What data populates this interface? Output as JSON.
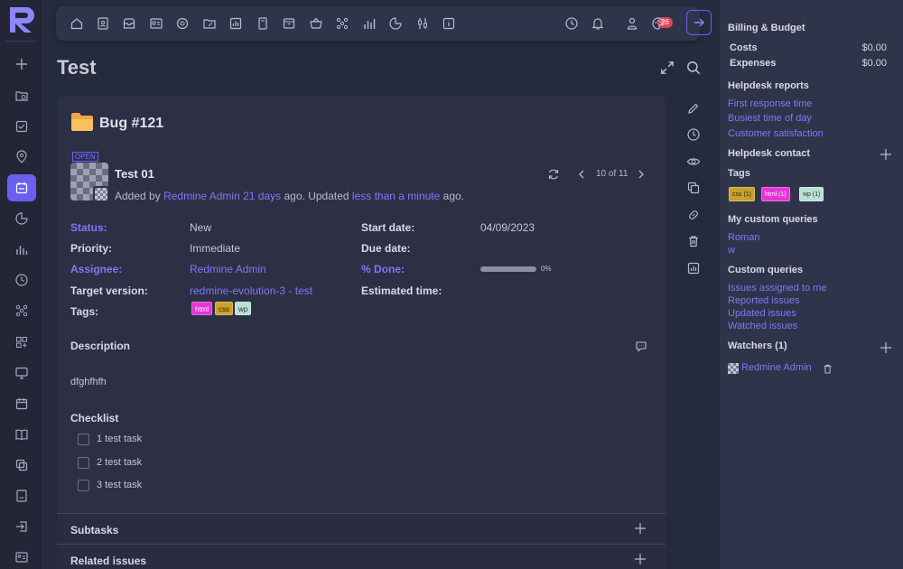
{
  "page": {
    "title": "Test"
  },
  "toolbar": {
    "icons": [
      "home-icon",
      "contacts-icon",
      "archive-icon",
      "id-card-icon",
      "target-icon",
      "folder-export-icon",
      "chart-icon",
      "notebook-icon",
      "inbox-icon",
      "basket-icon",
      "network-icon",
      "bars-icon",
      "pie-icon",
      "sliders-icon",
      "info-icon"
    ],
    "notifications_count": "26",
    "colors": {
      "accent": "#6b5ff0",
      "badge": "#e0455a"
    }
  },
  "issue": {
    "title": "Bug #121",
    "status_tag": "OPEN",
    "subject": "Test 01",
    "added_prefix": "Added by",
    "author": "Redmine Admin",
    "added_ago": "21 days",
    "middle": "ago. Updated",
    "updated_ago": "less than a minute",
    "suffix": "ago.",
    "pager": "10 of 11",
    "attributes": {
      "status_label": "Status:",
      "status_value": "New",
      "priority_label": "Priority:",
      "priority_value": "Immediate",
      "assignee_label": "Assignee:",
      "assignee_value": "Redmine Admin",
      "target_label": "Target version:",
      "target_value": "redmine-evolution-3 - test",
      "tags_label": "Tags:",
      "start_label": "Start date:",
      "start_value": "04/09/2023",
      "due_label": "Due date:",
      "done_label": "% Done:",
      "done_value": "0%",
      "done_fraction": 0,
      "estimated_label": "Estimated time:"
    },
    "tags": [
      {
        "label": "html",
        "color": "#e534d8"
      },
      {
        "label": "css",
        "color": "#c9a227"
      },
      {
        "label": "wp",
        "color": "#b9e0d8"
      }
    ],
    "description_title": "Description",
    "description": "dfghfhfh",
    "checklist_title": "Checklist",
    "checklist": [
      "1 test task",
      "2 test task",
      "3 test task"
    ],
    "subtasks_title": "Subtasks",
    "related_title": "Related issues"
  },
  "sidebar": {
    "billing_title": "Billing & Budget",
    "costs_label": "Costs",
    "costs_value": "$0.00",
    "expenses_label": "Expenses",
    "expenses_value": "$0.00",
    "helpdesk_reports_title": "Helpdesk reports",
    "helpdesk_reports": [
      "First response time",
      "Busiest time of day",
      "Customer satisfaction"
    ],
    "helpdesk_contact_title": "Helpdesk contact",
    "tags_title": "Tags",
    "tags": [
      {
        "label": "css (1)",
        "color": "#c9a227"
      },
      {
        "label": "html (1)",
        "color": "#e534d8"
      },
      {
        "label": "wp (1)",
        "color": "#b9e0d8"
      }
    ],
    "my_queries_title": "My custom queries",
    "my_queries": [
      "Roman",
      "w"
    ],
    "custom_queries_title": "Custom queries",
    "custom_queries": [
      "Issues assigned to me",
      "Reported issues",
      "Updated issues",
      "Watched issues"
    ],
    "watchers_title": "Watchers (1)",
    "watcher": "Redmine Admin"
  }
}
